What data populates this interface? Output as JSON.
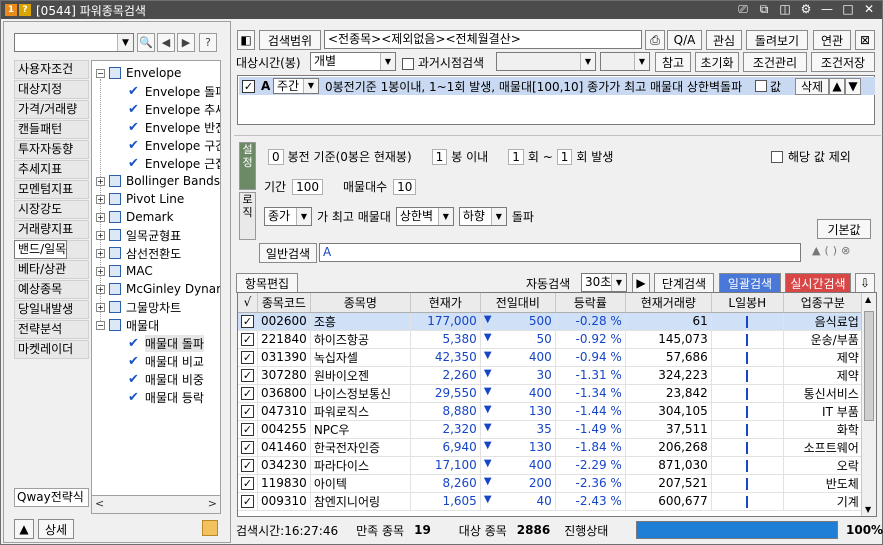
{
  "window": {
    "title": "[0544] 파워종목검색",
    "badges": [
      "1",
      "?"
    ],
    "controls": [
      "⎚",
      "⧉",
      "◫",
      "⚙",
      "—",
      "□",
      "✕"
    ]
  },
  "left": {
    "categories": [
      "사용자조건",
      "대상지정",
      "가격/거래량",
      "캔들패턴",
      "투자자동향",
      "추세지표",
      "모멘텀지표",
      "시장강도",
      "거래량지표",
      "밴드/일목",
      "재무지표",
      "베타/상관",
      "예상종목",
      "당일내발생",
      "전략분석",
      "마켓레이더"
    ],
    "selected_category": "밴드/일목",
    "tree": [
      {
        "label": "Envelope",
        "type": "folder",
        "level": 0,
        "state": "−"
      },
      {
        "label": "Envelope 돌파",
        "type": "check",
        "level": 1
      },
      {
        "label": "Envelope 추세",
        "type": "check",
        "level": 1
      },
      {
        "label": "Envelope 반전",
        "type": "check",
        "level": 1
      },
      {
        "label": "Envelope 구간",
        "type": "check",
        "level": 1
      },
      {
        "label": "Envelope 근접",
        "type": "check",
        "level": 1
      },
      {
        "label": "Bollinger Bands",
        "type": "folder",
        "level": 0,
        "state": "+"
      },
      {
        "label": "Pivot Line",
        "type": "folder",
        "level": 0,
        "state": "+"
      },
      {
        "label": "Demark",
        "type": "folder",
        "level": 0,
        "state": "+"
      },
      {
        "label": "일목균형표",
        "type": "folder",
        "level": 0,
        "state": "+"
      },
      {
        "label": "삼선전환도",
        "type": "folder",
        "level": 0,
        "state": "+"
      },
      {
        "label": "MAC",
        "type": "folder",
        "level": 0,
        "state": "+"
      },
      {
        "label": "McGinley Dynamic",
        "type": "folder",
        "level": 0,
        "state": "+"
      },
      {
        "label": "그물망차트",
        "type": "folder",
        "level": 0,
        "state": "+"
      },
      {
        "label": "매물대",
        "type": "folder",
        "level": 0,
        "state": "−"
      },
      {
        "label": "매물대 돌파",
        "type": "check",
        "level": 1,
        "highlight": true
      },
      {
        "label": "매물대 비교",
        "type": "check",
        "level": 1
      },
      {
        "label": "매물대 비중",
        "type": "check",
        "level": 1
      },
      {
        "label": "매물대 등락",
        "type": "check",
        "level": 1
      }
    ],
    "qway_label": "Qway전략식",
    "up_arrow": "▲",
    "detail_button": "상세",
    "folder_icon": "folder-icon"
  },
  "toolbar": {
    "range_button": "검색범위",
    "range_value": "<전종목><제외없음><전체월결산>",
    "qa_button": "Q/A",
    "interest_button": "관심",
    "review_button": "돌려보기",
    "link_button": "연관",
    "target_time_label": "대상시간(봉)",
    "target_time_value": "개별",
    "past_search_label": "과거시점검색",
    "ref_button": "참고",
    "reset_button": "초기화",
    "manage_button": "조건관리",
    "save_button": "조건저장"
  },
  "condition": {
    "letter": "A",
    "period": "주간",
    "text": "0봉전기준 1봉이내, 1~1회 발생, 매물대[100,10] 종가가 최고 매물대 상한벽돌파",
    "value_label": "값",
    "delete_button": "삭제",
    "up": "▲",
    "down": "▼"
  },
  "setup": {
    "tab1": "설정",
    "tab2": "로직",
    "bars_before": "0",
    "bars_before_label": "봉전 기준(0봉은 현재봉)",
    "within": "1",
    "within_label": "봉 이내",
    "count_from": "1",
    "count_mid": "회 ~",
    "count_to": "1",
    "count_label": "회 발생",
    "exclude_label": "해당 값 제외",
    "period_label": "기간",
    "period_value": "100",
    "volume_count_label": "매물대수",
    "volume_count_value": "10",
    "price_type": "종가",
    "most_label": "가 최고 매물대",
    "bound": "상한벽",
    "direction": "하향",
    "break_label": "돌파",
    "default_button": "기본값",
    "general_search_button": "일반검색",
    "formula": "A"
  },
  "results": {
    "item_edit_button": "항목편집",
    "auto_search_label": "자동검색",
    "interval": "30초",
    "step_search_button": "단계검색",
    "batch_search_button": "일괄검색",
    "realtime_search_button": "실시간검색",
    "columns": [
      "√",
      "종목코드",
      "종목명",
      "현재가",
      "전일대비",
      "등락률",
      "현재거래량",
      "L일봉H",
      "업종구분"
    ],
    "rows": [
      {
        "code": "002600",
        "name": "조흥",
        "price": "177,000",
        "change": "500",
        "rate": "-0.28 %",
        "volume": "61",
        "sector": "음식료업"
      },
      {
        "code": "221840",
        "name": "하이즈항공",
        "price": "5,380",
        "change": "50",
        "rate": "-0.92 %",
        "volume": "145,073",
        "sector": "운송/부품"
      },
      {
        "code": "031390",
        "name": "녹십자셀",
        "price": "42,350",
        "change": "400",
        "rate": "-0.94 %",
        "volume": "57,686",
        "sector": "제약"
      },
      {
        "code": "307280",
        "name": "원바이오젠",
        "price": "2,260",
        "change": "30",
        "rate": "-1.31 %",
        "volume": "324,223",
        "sector": "제약"
      },
      {
        "code": "036800",
        "name": "나이스정보통신",
        "price": "29,550",
        "change": "400",
        "rate": "-1.34 %",
        "volume": "23,842",
        "sector": "통신서비스"
      },
      {
        "code": "047310",
        "name": "파워로직스",
        "price": "8,880",
        "change": "130",
        "rate": "-1.44 %",
        "volume": "304,105",
        "sector": "IT 부품"
      },
      {
        "code": "004255",
        "name": "NPC우",
        "price": "2,320",
        "change": "35",
        "rate": "-1.49 %",
        "volume": "37,511",
        "sector": "화학"
      },
      {
        "code": "041460",
        "name": "한국전자인증",
        "price": "6,940",
        "change": "130",
        "rate": "-1.84 %",
        "volume": "206,268",
        "sector": "소프트웨어"
      },
      {
        "code": "034230",
        "name": "파라다이스",
        "price": "17,100",
        "change": "400",
        "rate": "-2.29 %",
        "volume": "871,030",
        "sector": "오락"
      },
      {
        "code": "119830",
        "name": "아이텍",
        "price": "8,260",
        "change": "200",
        "rate": "-2.36 %",
        "volume": "207,521",
        "sector": "반도체"
      },
      {
        "code": "009310",
        "name": "참엔지니어링",
        "price": "1,605",
        "change": "40",
        "rate": "-2.43 %",
        "volume": "600,677",
        "sector": "기계"
      }
    ]
  },
  "status": {
    "time_label": "검색시간:16:27:46",
    "match_label": "만족 종목",
    "match_count": "19",
    "target_label": "대상 종목",
    "target_count": "2886",
    "progress_label": "진행상태",
    "progress_value": "100%",
    "progress_fraction": 1.0
  },
  "colors": {
    "accent": "#1f7fd6",
    "down": "#1646c7",
    "batch_btn": "#4a78d8",
    "realtime_btn": "#d94646"
  }
}
